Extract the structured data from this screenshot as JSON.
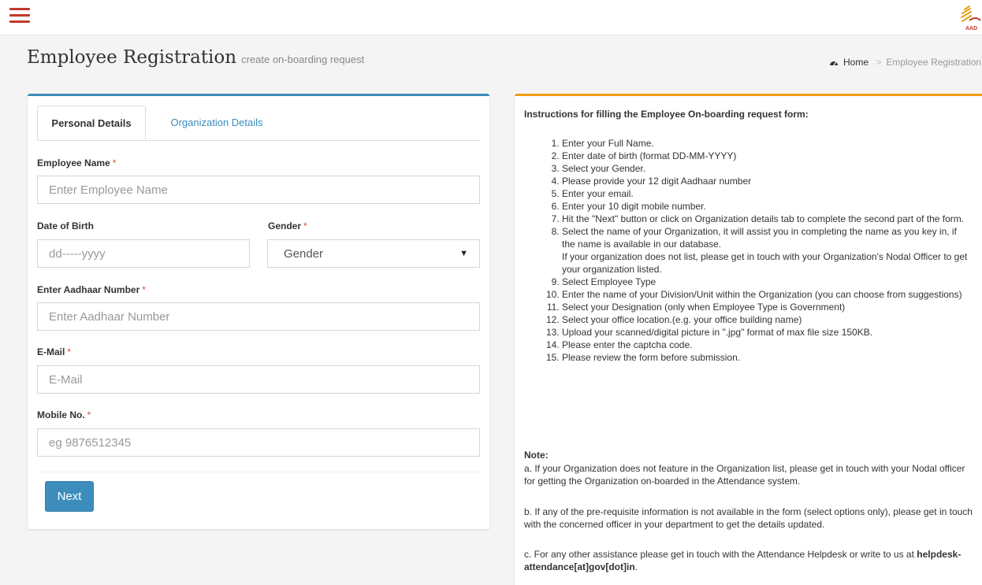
{
  "header": {
    "menu_icon": "hamburger-icon",
    "logo_icon": "aadhaar-logo-icon"
  },
  "page": {
    "title": "Employee Registration",
    "subtitle": "create on-boarding request",
    "breadcrumb": {
      "home": "Home",
      "current": "Employee Registration"
    }
  },
  "form": {
    "tabs": {
      "personal": "Personal Details",
      "organization": "Organization Details"
    },
    "employee_name": {
      "label": "Employee Name",
      "placeholder": "Enter Employee Name"
    },
    "dob": {
      "label": "Date of Birth",
      "placeholder": "dd-----yyyy"
    },
    "gender": {
      "label": "Gender",
      "value": "Gender"
    },
    "aadhaar": {
      "label": "Enter Aadhaar Number",
      "placeholder": "Enter Aadhaar Number"
    },
    "email": {
      "label": "E-Mail",
      "placeholder": "E-Mail"
    },
    "mobile": {
      "label": "Mobile No.",
      "placeholder": "eg 9876512345"
    },
    "required_mark": "*",
    "next_label": "Next"
  },
  "instructions": {
    "title": "Instructions for filling the Employee On-boarding request form:",
    "steps": [
      "Enter your Full Name.",
      "Enter date of birth (format DD-MM-YYYY)",
      "Select your Gender.",
      "Please provide your 12 digit Aadhaar number",
      "Enter your email.",
      "Enter your 10 digit mobile number.",
      "Hit the \"Next\" button or click on Organization details tab to complete the second part of the form.",
      "Select the name of your Organization, it will assist you in completing the name as you key in, if the name is available in our database.",
      "Select Employee Type",
      "Enter the name of your Division/Unit within the Organization (you can choose from suggestions)",
      "Select your Designation (only when Employee Type is Government)",
      "Select your office location.(e.g. your office building name)",
      "Upload your scanned/digital picture in \".jpg\" format of max file size 150KB.",
      "Please enter the captcha code.",
      "Please review the form before submission."
    ],
    "step8_extra": "If your organization does not list, please get in touch with your Organization's Nodal Officer to get your organization listed.",
    "note_title": "Note:",
    "note_a": "a. If your Organization does not feature in the Organization list, please get in touch with your Nodal officer for getting the Organization on-boarded in the Attendance system.",
    "note_b": "b. If any of the pre-requisite information is not available in the form (select options only), please get in touch with the concerned officer in your department to get the details updated.",
    "note_c_text": "c. For any other assistance please get in touch with the Attendance Helpdesk or write to us at",
    "note_c_email": "helpdesk-attendance[at]gov[dot]in",
    "note_c_end": "."
  }
}
